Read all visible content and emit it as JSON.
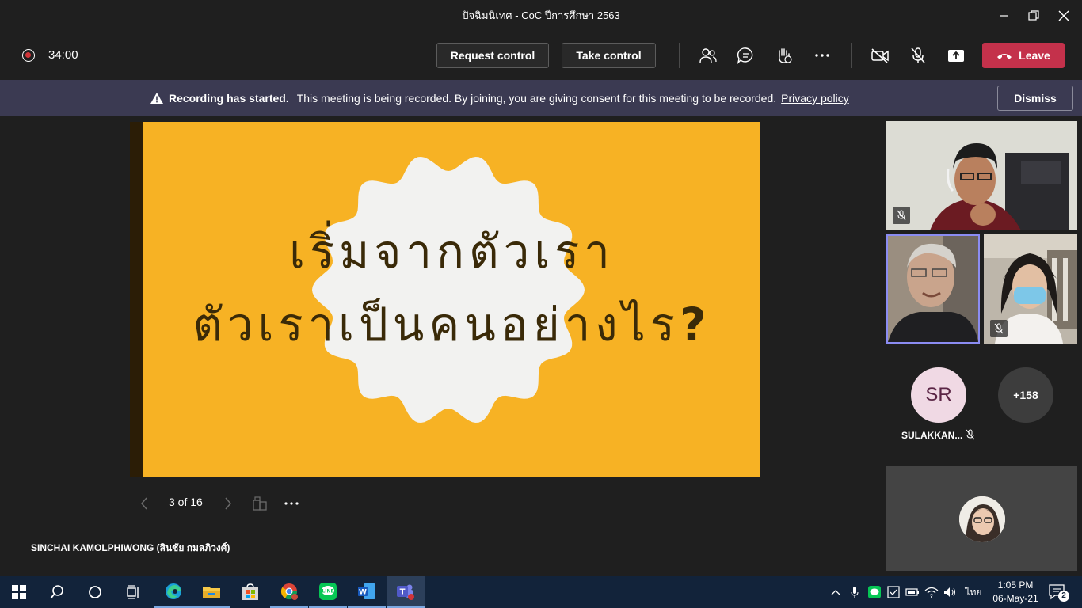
{
  "window": {
    "title": "ปัจฉิมนิเทศ - CoC ปีการศึกษา 2563"
  },
  "toolbar": {
    "timer": "34:00",
    "request_control": "Request control",
    "take_control": "Take control",
    "leave": "Leave",
    "icons": [
      "participants-icon",
      "chat-icon",
      "reactions-icon",
      "more-icon",
      "camera-off-icon",
      "mic-off-icon",
      "share-icon"
    ]
  },
  "banner": {
    "title": "Recording has started.",
    "message": "This meeting is being recorded. By joining, you are giving consent for this meeting to be recorded.",
    "link": "Privacy policy",
    "dismiss": "Dismiss"
  },
  "slide": {
    "line1": "เริ่มจากตัวเรา",
    "line2": "ตัวเราเป็นคนอย่างไร",
    "question_mark": "?",
    "colors": {
      "background": "#f7b224",
      "badge": "#f2f2f0",
      "text": "#3a2a08"
    }
  },
  "pager": {
    "label": "3 of 16"
  },
  "presenter": {
    "name": "SINCHAI KAMOLPHIWONG (สินชัย กมลภิวงศ์)"
  },
  "participants": {
    "sr_initials": "SR",
    "sr_name": "SULAKKAN...",
    "more_count": "+158"
  },
  "taskbar": {
    "apps": [
      "windows-start-icon",
      "search-icon",
      "cortana-icon",
      "task-view-icon",
      "edge-icon",
      "file-explorer-icon",
      "store-icon",
      "chrome-icon",
      "line-icon",
      "word-icon",
      "teams-icon"
    ],
    "lang": "ไทย",
    "time": "1:05 PM",
    "date": "06-May-21",
    "notifications": "2"
  }
}
